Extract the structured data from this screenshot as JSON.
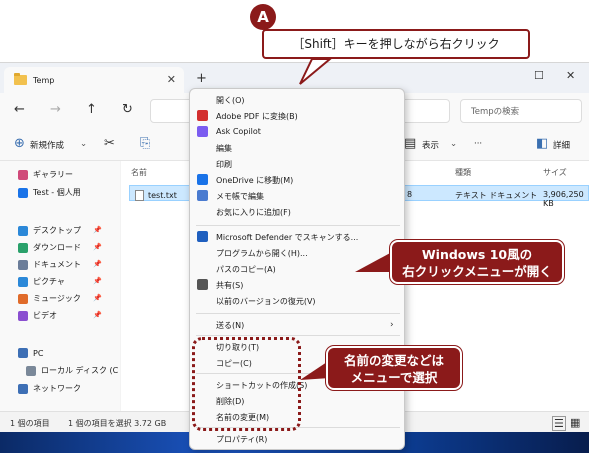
{
  "window": {
    "tab_title": "Temp",
    "search_placeholder": "Tempの検索",
    "new_button": "新規作成",
    "view_label": "表示",
    "details_label": "詳細",
    "columns": {
      "name": "名前",
      "type": "種類",
      "size": "サイズ"
    },
    "file": {
      "name": "test.txt",
      "date_tail": "8",
      "type": "テキスト ドキュメント",
      "size": "3,906,250 KB"
    },
    "sidebar": [
      {
        "label": "ギャラリー",
        "icon": "gallery-icon",
        "color": "#d04a7a"
      },
      {
        "label": "Test - 個人用",
        "icon": "onedrive-icon",
        "color": "#1a73e8"
      },
      {
        "label": "デスクトップ",
        "icon": "desktop-icon",
        "color": "#2b88d8"
      },
      {
        "label": "ダウンロード",
        "icon": "download-icon",
        "color": "#2aa16b"
      },
      {
        "label": "ドキュメント",
        "icon": "documents-icon",
        "color": "#6b7d99"
      },
      {
        "label": "ピクチャ",
        "icon": "pictures-icon",
        "color": "#2b88d8"
      },
      {
        "label": "ミュージック",
        "icon": "music-icon",
        "color": "#e06b2a"
      },
      {
        "label": "ビデオ",
        "icon": "videos-icon",
        "color": "#8a4fd0"
      },
      {
        "label": "PC",
        "icon": "pc-icon",
        "color": "#3d6fb5"
      },
      {
        "label": "ローカル ディスク (C",
        "icon": "drive-icon",
        "color": "#7a8899"
      },
      {
        "label": "ネットワーク",
        "icon": "network-icon",
        "color": "#3d6fb5"
      }
    ],
    "status_items": "1 個の項目",
    "status_selected": "1 個の項目を選択  3.72 GB"
  },
  "context_menu": {
    "items": [
      "開く(O)",
      "Adobe PDF に変換(B)",
      "Ask Copilot",
      "編集",
      "印刷",
      "OneDrive に移動(M)",
      "メモ帳で編集",
      "お気に入りに追加(F)",
      "Microsoft Defender でスキャンする...",
      "プログラムから開く(H)...",
      "パスのコピー(A)",
      "共有(S)",
      "以前のバージョンの復元(V)",
      "送る(N)",
      "切り取り(T)",
      "コピー(C)",
      "ショートカットの作成(S)",
      "削除(D)",
      "名前の変更(M)",
      "プロパティ(R)"
    ]
  },
  "annotations": {
    "badge": "A",
    "top_callout": "［Shift］キーを押しながら右クリック",
    "right_callout_line1": "Windows 10風の",
    "right_callout_line2": "右クリックメニューが開く",
    "bottom_callout_line1": "名前の変更などは",
    "bottom_callout_line2": "メニューで選択"
  },
  "colors": {
    "accent": "#8b1a1a",
    "selection": "#cce8ff"
  }
}
